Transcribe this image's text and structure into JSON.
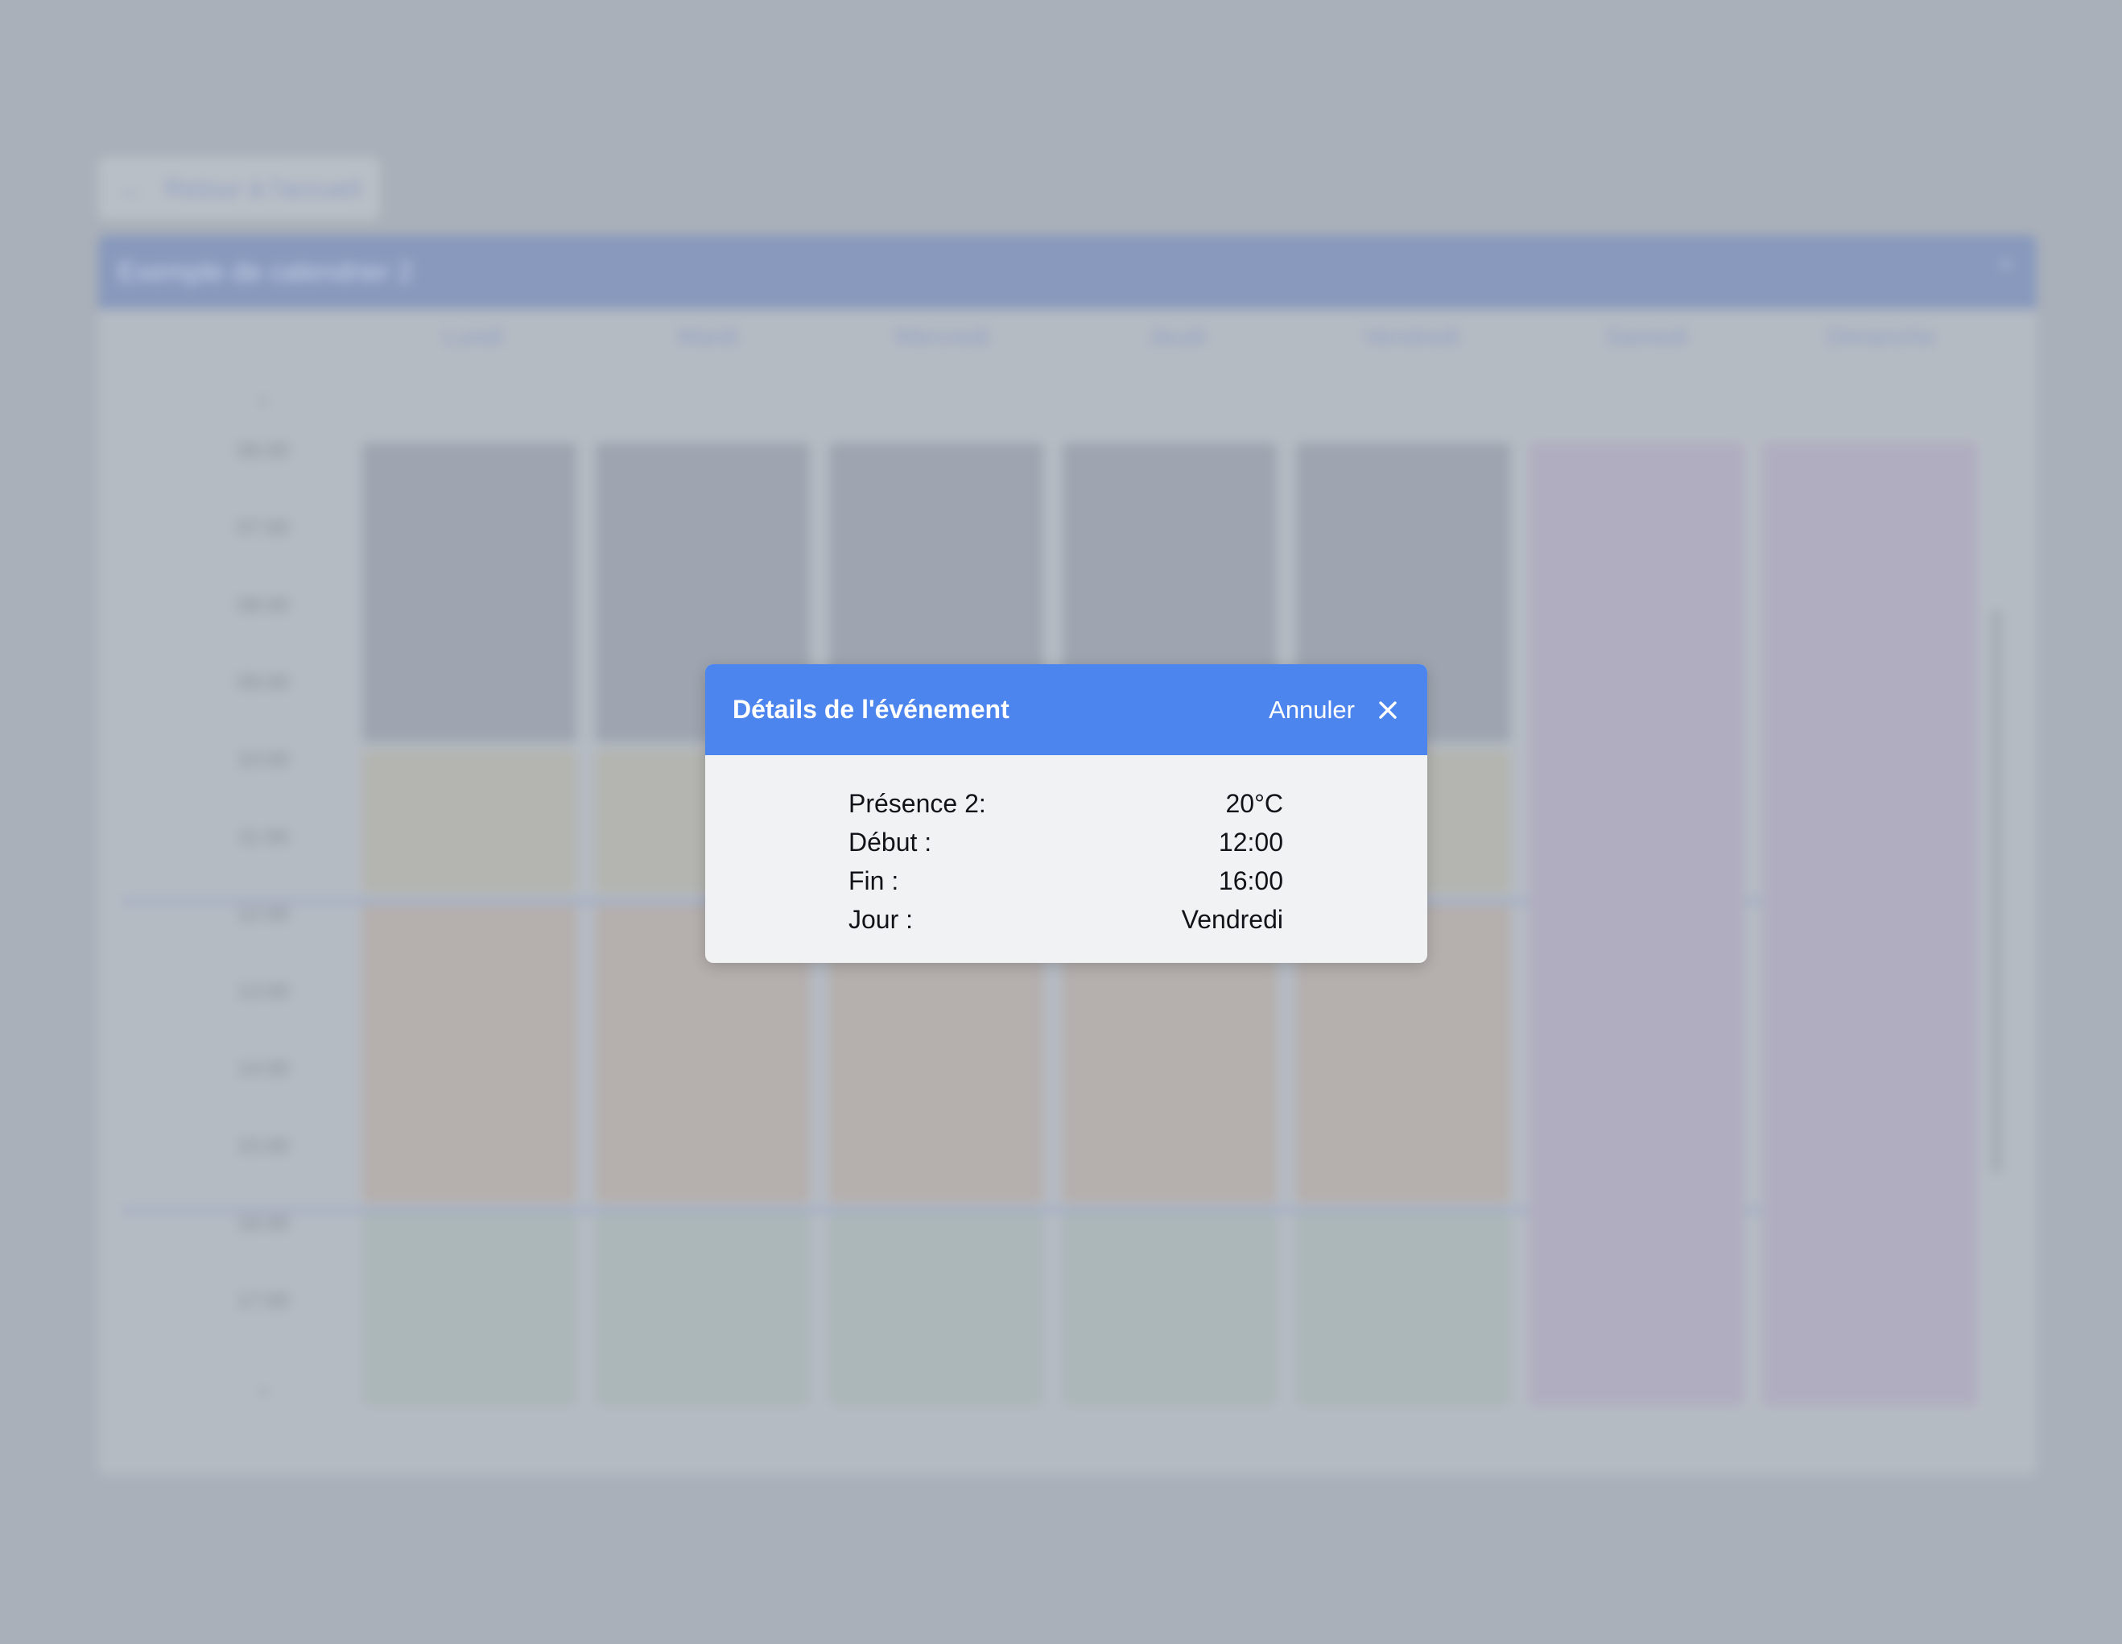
{
  "background": {
    "back_button": {
      "label": "Retour à l'accueil"
    },
    "calendar": {
      "title": "Exemple de calendrier 2",
      "days": [
        "Lundi",
        "Mardi",
        "Mercredi",
        "Jeudi",
        "Vendredi",
        "Samedi",
        "Dimanche"
      ],
      "hours": [
        "06:00",
        "07:00",
        "08:00",
        "09:00",
        "10:00",
        "11:00",
        "12:00",
        "13:00",
        "14:00",
        "15:00",
        "16:00",
        "17:00"
      ]
    }
  },
  "modal": {
    "title": "Détails de l'événement",
    "cancel_label": "Annuler",
    "rows": [
      {
        "label": "Présence 2:",
        "value": "20°C"
      },
      {
        "label": "Début :",
        "value": "12:00"
      },
      {
        "label": "Fin :",
        "value": "16:00"
      },
      {
        "label": "Jour :",
        "value": "Vendredi"
      }
    ]
  },
  "colors": {
    "modal_header": "#4d85ee",
    "overlay": "#a9b0b9"
  }
}
